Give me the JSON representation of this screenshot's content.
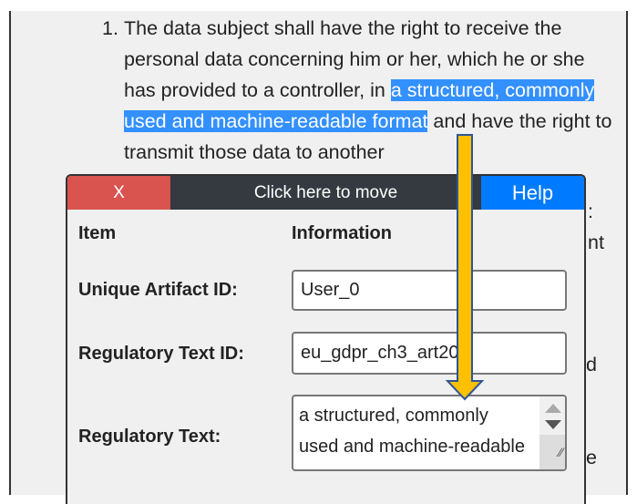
{
  "document": {
    "list_number": "1.",
    "text_before": "The data subject shall have the right to receive the personal data concerning him or her, which he or she has provided to a controller, in ",
    "highlighted": "a structured, commonly used and machine-readable format",
    "text_after": " and have the right to transmit those data to another",
    "partial_fragments": [
      ":",
      "nt",
      "d",
      "e"
    ]
  },
  "dialog": {
    "close_label": "X",
    "move_label": "Click here to move",
    "help_label": "Help",
    "col_item": "Item",
    "col_info": "Information",
    "fields": [
      {
        "label": "Unique Artifact ID:",
        "value": "User_0"
      },
      {
        "label": "Regulatory Text ID:",
        "value": "eu_gdpr_ch3_art20"
      },
      {
        "label": "Regulatory Text:",
        "value": "a structured, commonly used and machine-readable format"
      }
    ]
  },
  "colors": {
    "close": "#d9534f",
    "move": "#343a40",
    "help": "#007bff",
    "highlight": "#3390ff",
    "arrow": "#ffc000",
    "arrow_outline": "#2f5597"
  }
}
